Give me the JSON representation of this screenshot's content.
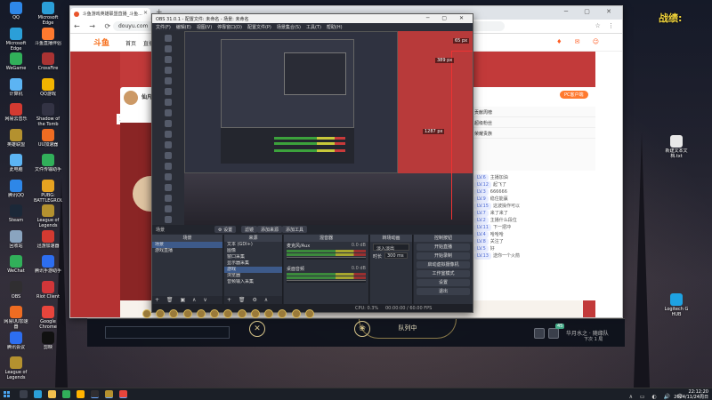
{
  "desktop": {
    "left_icons": [
      {
        "label": "QQ",
        "color": "#2e87e8"
      },
      {
        "label": "Microsoft Edge",
        "color": "#2b9fd8"
      },
      {
        "label": "WeGame",
        "color": "#31b05a"
      },
      {
        "label": "计算机",
        "color": "#5cb4f3"
      },
      {
        "label": "网易云音乐",
        "color": "#d33a31"
      },
      {
        "label": "英雄联盟",
        "color": "#b4912f"
      },
      {
        "label": "此电脑",
        "color": "#5cb4f3"
      },
      {
        "label": "腾讯QQ",
        "color": "#2e87e8"
      },
      {
        "label": "Steam",
        "color": "#1b2838"
      },
      {
        "label": "回收站",
        "color": "#8aa4bf"
      },
      {
        "label": "WeChat",
        "color": "#31b05a"
      },
      {
        "label": "OBS",
        "color": "#302e31"
      },
      {
        "label": "网易UU加速器",
        "color": "#ef6c22"
      },
      {
        "label": "腾讯会议",
        "color": "#2d6ef0"
      },
      {
        "label": "League of Legends",
        "color": "#b4912f"
      },
      {
        "label": "Microsoft Edge",
        "color": "#2b9fd8"
      },
      {
        "label": "斗鱼直播伴侣",
        "color": "#ff7a2f"
      },
      {
        "label": "CrossFire",
        "color": "#a33"
      },
      {
        "label": "QQ游戏",
        "color": "#f2b400"
      },
      {
        "label": "Shadow of the Tomb Raider",
        "color": "#334"
      },
      {
        "label": "UU加速器",
        "color": "#ef6c22"
      },
      {
        "label": "文件传输助手",
        "color": "#31b05a"
      },
      {
        "label": "PUBG: BATTLEGROUNDS",
        "color": "#e7a321"
      },
      {
        "label": "League of Legends",
        "color": "#b4912f"
      },
      {
        "label": "迅游加速器",
        "color": "#d33a31"
      },
      {
        "label": "腾讯手游助手",
        "color": "#2d6ef0"
      },
      {
        "label": "Riot Client",
        "color": "#d13639"
      },
      {
        "label": "Google Chrome",
        "color": "#e8453c"
      },
      {
        "label": "剪映",
        "color": "#111"
      }
    ],
    "right_icons": [
      {
        "label": "新建文本文档.txt",
        "color": "#e8e8e8"
      },
      {
        "label": "Logitech G HUB",
        "color": "#1ea2e2"
      }
    ],
    "sogou_overlay": "战绩:"
  },
  "browser": {
    "tab_title": "斗鱼游戏英雄联盟直播_斗鱼...",
    "url": "douyu.com",
    "nav_glyphs": "← → ⟳",
    "ext_glyphs": "☆ ⋮",
    "window_controls": "─ ▢ ✕"
  },
  "douyu": {
    "logo": "斗鱼",
    "nav": "首页  直播  分类",
    "header_right": "♦ ✉ ☺",
    "streamer_name": "仙凡",
    "follow_count": "12",
    "rank_rows": [
      "贡献周榜",
      "超级粉丝",
      "荣耀贵族"
    ],
    "chat_lines": [
      {
        "tag": "LV.6",
        "text": "主播加油"
      },
      {
        "tag": "LV.12",
        "text": "起飞了"
      },
      {
        "tag": "LV.3",
        "text": "666666"
      },
      {
        "tag": "LV.9",
        "text": "稳住能赢"
      },
      {
        "tag": "LV.15",
        "text": "这波操作可以"
      },
      {
        "tag": "LV.7",
        "text": "来了来了"
      },
      {
        "tag": "LV.2",
        "text": "主播什么段位"
      },
      {
        "tag": "LV.11",
        "text": "下一把冲"
      },
      {
        "tag": "LV.4",
        "text": "哈哈哈"
      },
      {
        "tag": "LV.8",
        "text": "关注了"
      },
      {
        "tag": "LV.5",
        "text": "好"
      },
      {
        "tag": "LV.13",
        "text": "送你一个火箭"
      }
    ],
    "pill_label": "PC客户端"
  },
  "obs": {
    "title": "OBS 31.0.1 - 配置文件: 未命名 - 场景: 未命名",
    "menu": [
      "文件(F)",
      "编辑(E)",
      "视图(V)",
      "停靠窗口(D)",
      "配置文件(P)",
      "场景集合(S)",
      "工具(T)",
      "帮助(H)"
    ],
    "window_controls": "─ ▢ ✕",
    "preview_labels": {
      "top_px": "65 px",
      "right_px": "389 px",
      "side_px": "1287 px"
    },
    "scene_bar": {
      "scene_name": "场景",
      "buttons": [
        "⚙ 设置",
        "滤镜",
        "添加来源",
        "添加工具"
      ]
    },
    "docks": {
      "scenes": {
        "title": "场景",
        "items": [
          "场景",
          "游戏直播"
        ],
        "foot": "+ 🗑 ▣ ∧ ∨"
      },
      "sources": {
        "title": "来源",
        "items": [
          "文本 (GDI+)",
          "图像",
          "窗口采集",
          "显示器采集",
          "游戏",
          "浏览器",
          "音频输入采集"
        ],
        "selected_index": 4,
        "foot": "+ 🗑 ⚙ ∧ ∨"
      },
      "mixer": {
        "title": "混音器",
        "channels": [
          {
            "name": "麦克风/Aux",
            "db": "0.0 dB"
          },
          {
            "name": "桌面音频",
            "db": "0.0 dB"
          }
        ]
      },
      "transitions": {
        "title": "转场动画",
        "type": "淡入淡出",
        "duration_label": "时长",
        "duration": "300 ms"
      },
      "controls": {
        "title": "控制按钮",
        "buttons": [
          "开始直播",
          "开始录制",
          "启动虚拟摄像机",
          "工作室模式",
          "设置",
          "退出"
        ]
      }
    },
    "status": {
      "cpu": "CPU: 0.3%",
      "fps": "00:00:00 / 60.00 FPS"
    }
  },
  "game": {
    "queue_label": "队列中",
    "left_glyph": "✕",
    "right_glyph": "❀",
    "badge": "45",
    "right_text": "华月水之 · 随缘队",
    "right_text2": "下次 1 局"
  },
  "taskbar": {
    "time": "22:12:20",
    "date": "2024/11/24周日",
    "tray_glyphs": "∧ ▭ ◐ 🔊 中"
  }
}
